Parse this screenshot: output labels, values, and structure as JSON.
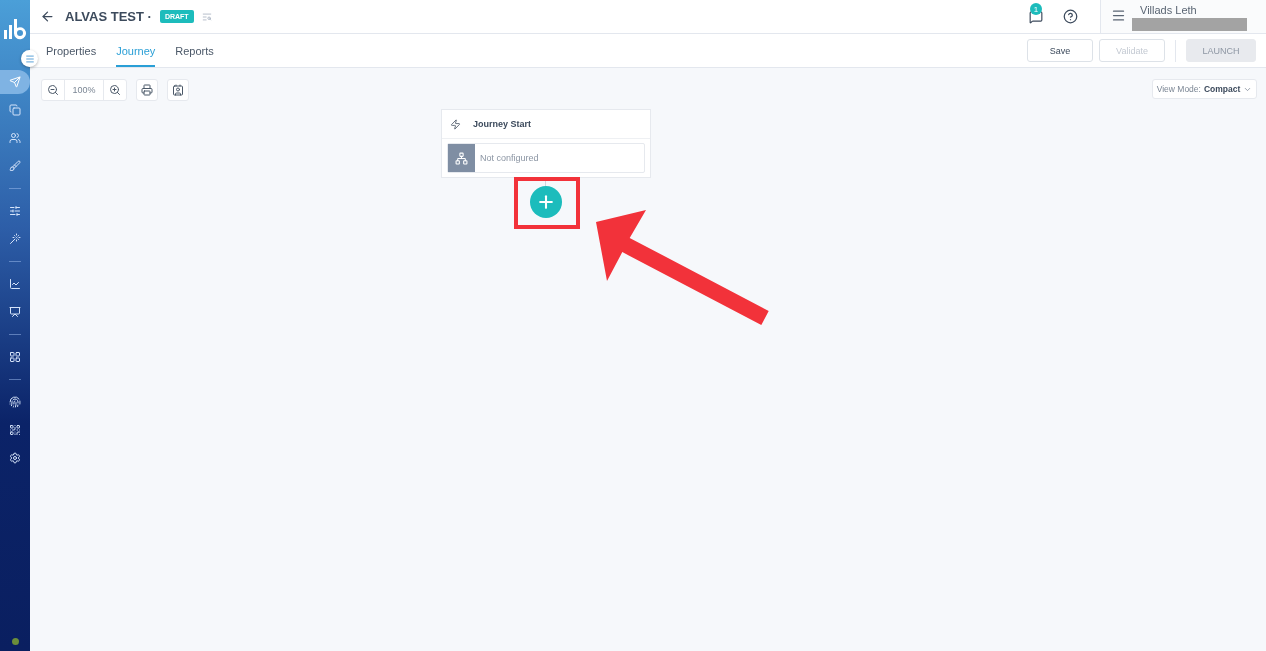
{
  "sidebar": {
    "items": [
      {
        "kind": "icon",
        "selected": true
      },
      {
        "kind": "icon",
        "selected": false
      },
      {
        "kind": "icon",
        "selected": false
      },
      {
        "kind": "icon",
        "selected": false
      },
      {
        "kind": "divider"
      },
      {
        "kind": "icon",
        "selected": false
      },
      {
        "kind": "icon",
        "selected": false
      },
      {
        "kind": "divider"
      },
      {
        "kind": "icon",
        "selected": false
      },
      {
        "kind": "icon",
        "selected": false
      },
      {
        "kind": "divider"
      },
      {
        "kind": "icon",
        "selected": false
      },
      {
        "kind": "divider"
      },
      {
        "kind": "icon",
        "selected": false
      },
      {
        "kind": "icon",
        "selected": false
      },
      {
        "kind": "icon",
        "selected": false
      }
    ]
  },
  "header": {
    "title": "ALVAS TEST ·",
    "status": "DRAFT",
    "notification_count": "1",
    "user_name": "Villads Leth"
  },
  "tabs": [
    {
      "label": "Properties",
      "selected": false
    },
    {
      "label": "Journey",
      "selected": true
    },
    {
      "label": "Reports",
      "selected": false
    }
  ],
  "actions": [
    {
      "label": "Save",
      "kind": "secondary",
      "disabled": false
    },
    {
      "label": "Validate",
      "kind": "secondary",
      "disabled": true
    },
    {
      "label": "LAUNCH",
      "kind": "primary",
      "disabled": true
    }
  ],
  "zoom": {
    "value": "100%"
  },
  "view_mode": {
    "label": "View Mode:",
    "value": "Compact"
  },
  "journey_start": {
    "title": "Journey Start",
    "entry": "Not configured"
  }
}
